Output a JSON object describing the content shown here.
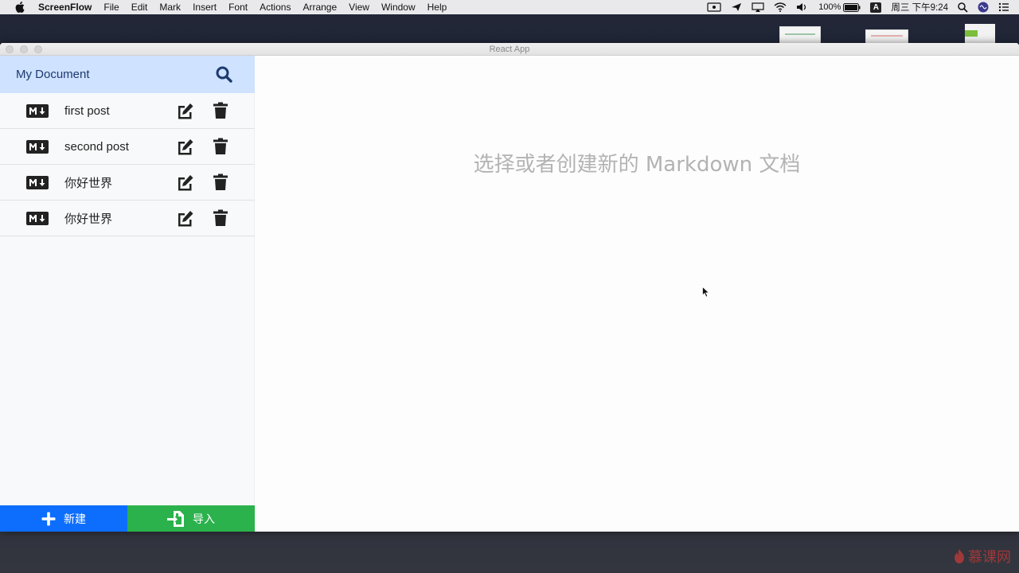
{
  "menubar": {
    "app_name": "ScreenFlow",
    "items": [
      "File",
      "Edit",
      "Mark",
      "Insert",
      "Font",
      "Actions",
      "Arrange",
      "View",
      "Window",
      "Help"
    ],
    "battery": "100%",
    "input_source": "A",
    "clock": "周三 下午9:24"
  },
  "window": {
    "title": "React App"
  },
  "sidebar": {
    "title": "My Document",
    "files": [
      {
        "name": "first post"
      },
      {
        "name": "second post"
      },
      {
        "name": "你好世界"
      },
      {
        "name": "你好世界"
      }
    ],
    "new_button": "新建",
    "import_button": "导入"
  },
  "main": {
    "placeholder": "选择或者创建新的 Markdown 文档"
  },
  "watermark": {
    "text": "慕课网"
  },
  "colors": {
    "header_bg": "#cfe2ff",
    "new_btn": "#0d6efd",
    "import_btn": "#2bb24c",
    "placeholder_text": "#b3b3b3"
  },
  "icons": {
    "search": "search-icon",
    "markdown": "markdown-icon",
    "edit": "edit-icon",
    "delete": "trash-icon",
    "add": "plus-icon",
    "import": "file-import-icon"
  }
}
